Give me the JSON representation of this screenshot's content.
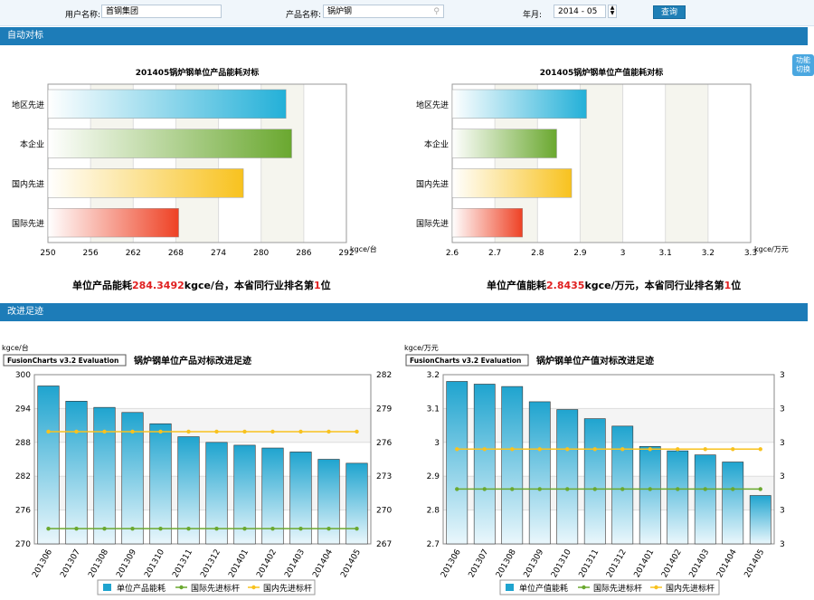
{
  "filters": {
    "user_label": "用户名称:",
    "user_value": "首钢集团",
    "product_label": "产品名称:",
    "product_value": "锅炉钢",
    "month_label": "年月:",
    "month_value": "2014 - 05",
    "query_label": "查询"
  },
  "side_button": {
    "line1": "功能",
    "line2": "切换"
  },
  "sections": {
    "auto": "自动对标",
    "improve": "改进足迹"
  },
  "summary1": {
    "pre": "单位产品能耗",
    "value": "284.3492",
    "mid": "kgce/台，本省同行业排名第",
    "rank": "1",
    "post": "位"
  },
  "summary2": {
    "pre": "单位产值能耗",
    "value": "2.8435",
    "mid": "kgce/万元，本省同行业排名第",
    "rank": "1",
    "post": "位"
  },
  "watermark": "FusionCharts v3.2 Evaluation",
  "chart_data": [
    {
      "type": "bar",
      "title": "201405锅炉钢单位产品能耗对标",
      "unit": "kgce/台",
      "categories": [
        "地区先进",
        "本企业",
        "国内先进",
        "国际先进"
      ],
      "values": [
        283.5,
        284.3,
        277.5,
        268.4
      ],
      "xlim": [
        250,
        292
      ],
      "ticks": [
        "250",
        "256",
        "262",
        "268",
        "274",
        "280",
        "286",
        "292"
      ],
      "colors": [
        "#23b0d8",
        "#6aa82f",
        "#f8c21e",
        "#ee4124"
      ]
    },
    {
      "type": "bar",
      "title": "201405锅炉钢单位产值能耗对标",
      "unit": "kgce/万元",
      "categories": [
        "地区先进",
        "本企业",
        "国内先进",
        "国际先进"
      ],
      "values": [
        2.915,
        2.845,
        2.88,
        2.765
      ],
      "xlim": [
        2.6,
        3.3
      ],
      "ticks": [
        "2.6",
        "2.7",
        "2.8",
        "2.9",
        "3",
        "3.1",
        "3.2",
        "3.3"
      ],
      "colors": [
        "#23b0d8",
        "#6aa82f",
        "#f8c21e",
        "#ee4124"
      ]
    },
    {
      "type": "bar+line",
      "title": "锅炉钢单位产品对标改进足迹",
      "unit": "kgce/台",
      "categories": [
        "201306",
        "201307",
        "201308",
        "201309",
        "201310",
        "201311",
        "201312",
        "201401",
        "201402",
        "201403",
        "201404",
        "201405"
      ],
      "series": [
        {
          "name": "单位产品能耗",
          "values": [
            298,
            295.3,
            294.2,
            293.3,
            291.3,
            289,
            288,
            287.5,
            287,
            286.3,
            285,
            284.3
          ],
          "color": "#1fa4cf"
        },
        {
          "name": "国际先进标杆",
          "values": [
            272.7,
            272.7,
            272.7,
            272.7,
            272.7,
            272.7,
            272.7,
            272.7,
            272.7,
            272.7,
            272.7,
            272.7
          ],
          "color": "#6aa82f"
        },
        {
          "name": "国内先进标杆",
          "values": [
            289.9,
            289.9,
            289.9,
            289.9,
            289.9,
            289.9,
            289.9,
            289.9,
            289.9,
            289.9,
            289.9,
            289.9
          ],
          "color": "#f8c21e"
        }
      ],
      "ylim": [
        270,
        300
      ],
      "left_ticks": [
        "270",
        "276",
        "282",
        "288",
        "294",
        "300"
      ],
      "right_ticks": [
        "267",
        "270",
        "273",
        "276",
        "279",
        "282"
      ]
    },
    {
      "type": "bar+line",
      "title": "锅炉钢单位产值对标改进足迹",
      "unit": "kgce/万元",
      "categories": [
        "201306",
        "201307",
        "201308",
        "201309",
        "201310",
        "201311",
        "201312",
        "201401",
        "201402",
        "201403",
        "201404",
        "201405"
      ],
      "series": [
        {
          "name": "单位产值能耗",
          "values": [
            3.18,
            3.172,
            3.165,
            3.12,
            3.097,
            3.07,
            3.048,
            2.988,
            2.975,
            2.963,
            2.942,
            2.843
          ],
          "color": "#1fa4cf"
        },
        {
          "name": "国际先进标杆",
          "values": [
            2.862,
            2.862,
            2.862,
            2.862,
            2.862,
            2.862,
            2.862,
            2.862,
            2.862,
            2.862,
            2.862,
            2.862
          ],
          "color": "#6aa82f"
        },
        {
          "name": "国内先进标杆",
          "values": [
            2.98,
            2.98,
            2.98,
            2.98,
            2.98,
            2.98,
            2.98,
            2.98,
            2.98,
            2.98,
            2.98,
            2.98
          ],
          "color": "#f8c21e"
        }
      ],
      "ylim": [
        2.7,
        3.2
      ],
      "left_ticks": [
        "2.7",
        "2.8",
        "2.9",
        "3",
        "3.1",
        "3.2"
      ],
      "right_ticks": [
        "3",
        "3",
        "3",
        "3",
        "3",
        "3"
      ]
    }
  ]
}
